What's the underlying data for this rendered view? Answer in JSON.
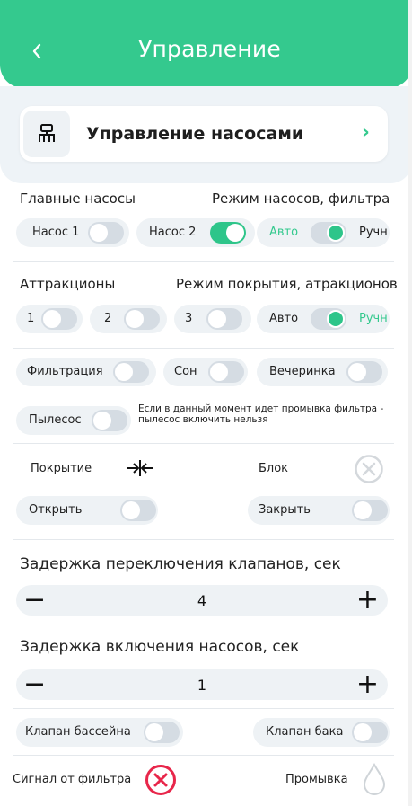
{
  "header": {
    "title": "Управление",
    "back_icon": "chevron-left-icon"
  },
  "nav_card": {
    "label": "Управление насосами",
    "icon": "pump-manifold-icon",
    "chevron": "›"
  },
  "main_pumps": {
    "title": "Главные насосы",
    "mode_title": "Режим насосов, фильтра",
    "pump1": {
      "label": "Насос 1",
      "on": false
    },
    "pump2": {
      "label": "Насос 2",
      "on": true
    },
    "mode": {
      "auto": "Авто",
      "manual": "Ручн",
      "selected": "auto"
    }
  },
  "attractions": {
    "title": "Аттракционы",
    "mode_title": "Режим покрытия, атракционов",
    "a1": {
      "label": "1",
      "on": false
    },
    "a2": {
      "label": "2",
      "on": false
    },
    "a3": {
      "label": "3",
      "on": false
    },
    "mode": {
      "auto": "Авто",
      "manual": "Ручн",
      "selected": "manual"
    }
  },
  "modes": {
    "filtration": {
      "label": "Фильтрация",
      "on": false
    },
    "sleep": {
      "label": "Сон",
      "on": false
    },
    "party": {
      "label": "Вечеринка",
      "on": false
    },
    "vacuum": {
      "label": "Пылесос",
      "on": false
    },
    "vacuum_note": "Если в данный момент идет промывка фильтра - пылесос включить нельзя"
  },
  "cover": {
    "label": "Покрытие",
    "cover_icon": "arrows-converge-icon",
    "block_label": "Блок",
    "block_icon": "circle-x-icon",
    "open_label": "Открыть",
    "close_label": "Закрыть"
  },
  "valve_delay": {
    "title": "Задержка переключения клапанов, сек",
    "value": "4",
    "minus": "−",
    "plus": "+"
  },
  "pump_delay": {
    "title": "Задержка включения насосов, сек",
    "value": "1",
    "minus": "−",
    "plus": "+"
  },
  "valves": {
    "pool": {
      "label": "Клапан бассейна",
      "on": false
    },
    "tank": {
      "label": "Клапан бака",
      "on": false
    }
  },
  "status": {
    "filter_signal": "Сигнал от фильтра",
    "filter_signal_icon": "error-circle-x-icon",
    "flush": "Промывка",
    "flush_icon": "water-drop-icon"
  },
  "colors": {
    "accent": "#34c98e",
    "toggle_off": "#d5dce3",
    "pill_bg": "#eef2f5",
    "error": "#e8264a"
  }
}
